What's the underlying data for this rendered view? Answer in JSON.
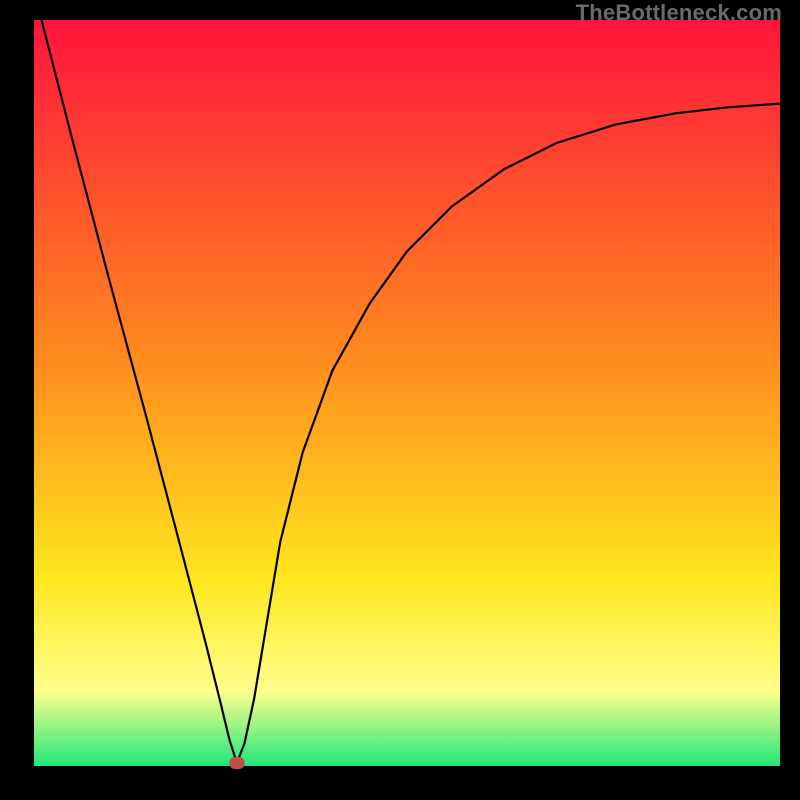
{
  "watermark": "TheBottleneck.com",
  "gradient": {
    "stop_top": "#ff143c",
    "stop_mid1": "#ff8a1e",
    "stop_mid2": "#ffe61e",
    "stop_mid3": "#ffff8c",
    "stop_bottom": "#20e67a"
  },
  "curve": {
    "color": "#000000",
    "stroke_width": 2.2
  },
  "marker": {
    "x_frac": 0.272,
    "y_frac": 0.996,
    "color": "#c05048"
  },
  "chart_data": {
    "type": "line",
    "title": "",
    "xlabel": "",
    "ylabel": "",
    "xlim": [
      0,
      1
    ],
    "ylim": [
      0,
      1
    ],
    "note": "Axis values are normalized fractions of the plot area; the image has no numeric tick labels. y=1 corresponds to the top of the colored region, y=0 to the bottom. Curve shows a V-shaped bottleneck dip reaching ~0 near x≈0.27 then rising toward the right.",
    "series": [
      {
        "name": "bottleneck-curve",
        "x": [
          0.01,
          0.05,
          0.1,
          0.15,
          0.2,
          0.23,
          0.25,
          0.262,
          0.272,
          0.282,
          0.295,
          0.31,
          0.33,
          0.36,
          0.4,
          0.45,
          0.5,
          0.56,
          0.63,
          0.7,
          0.78,
          0.86,
          0.93,
          1.0
        ],
        "y": [
          1.0,
          0.845,
          0.655,
          0.47,
          0.28,
          0.165,
          0.085,
          0.035,
          0.004,
          0.03,
          0.09,
          0.18,
          0.3,
          0.42,
          0.53,
          0.62,
          0.69,
          0.75,
          0.8,
          0.835,
          0.86,
          0.875,
          0.883,
          0.888
        ]
      }
    ],
    "marker_point": {
      "x": 0.272,
      "y": 0.004
    }
  }
}
